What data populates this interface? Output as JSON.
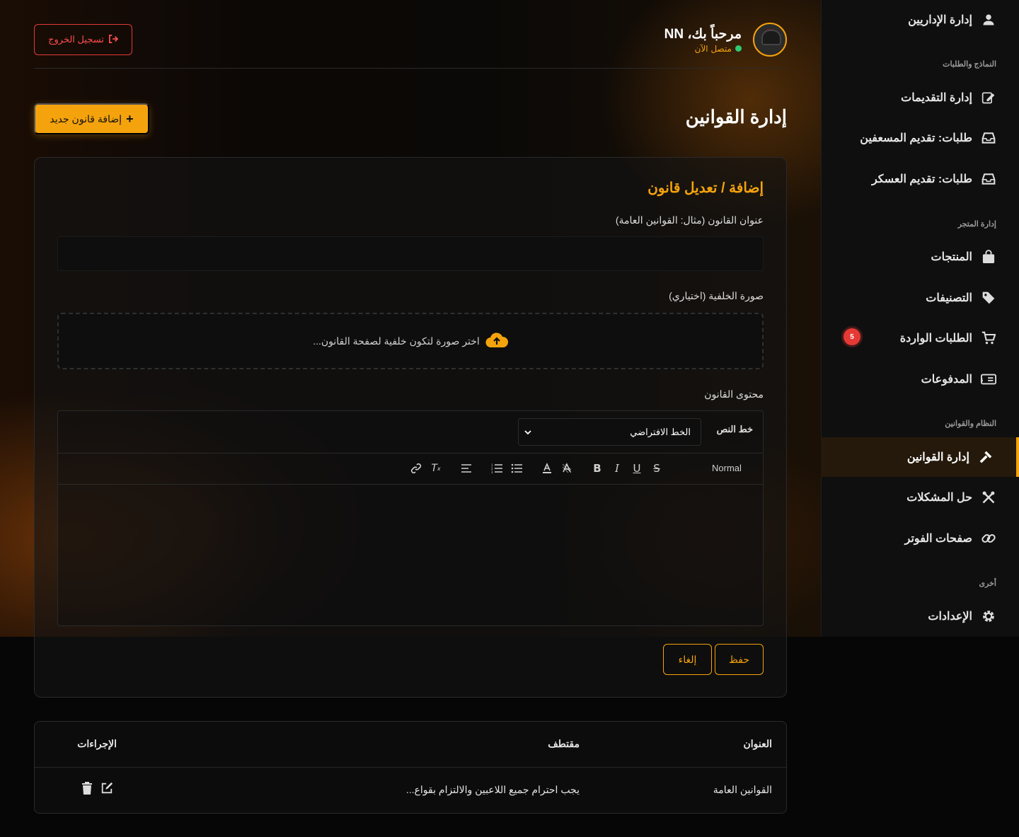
{
  "sidebar": {
    "items": [
      {
        "label": "إدارة الإداريين",
        "icon": "user-icon"
      },
      {
        "label": "إدارة التقديمات",
        "icon": "edit-form-icon"
      },
      {
        "label": "طلبات: تقديم المسعفين",
        "icon": "inbox-icon"
      },
      {
        "label": "طلبات: تقديم العسكر",
        "icon": "inbox-icon"
      },
      {
        "label": "المنتجات",
        "icon": "shopping-bag-icon"
      },
      {
        "label": "التصنيفات",
        "icon": "tags-icon"
      },
      {
        "label": "الطلبات الواردة",
        "icon": "cart-icon",
        "badge": "5"
      },
      {
        "label": "المدفوعات",
        "icon": "money-bill-icon"
      },
      {
        "label": "إدارة القوانين",
        "icon": "gavel-icon",
        "active": true
      },
      {
        "label": "حل المشكلات",
        "icon": "tools-icon"
      },
      {
        "label": "صفحات الفوتر",
        "icon": "link-icon"
      },
      {
        "label": "الإعدادات",
        "icon": "gear-icon"
      }
    ],
    "sections": {
      "forms": "النماذج والطلبات",
      "store": "إدارة المتجر",
      "system": "النظام والقوانين",
      "other": "أخرى"
    }
  },
  "header": {
    "welcome": "مرحباً بك، NN",
    "status": "متصل الآن",
    "logout_label": "تسجيل الخروج"
  },
  "page": {
    "title": "إدارة القوانين",
    "add_button": "إضافة قانون جديد"
  },
  "form": {
    "title": "إضافة / تعديل قانون",
    "title_label": "عنوان القانون (مثال: القوانين العامة)",
    "title_value": "",
    "bg_label": "صورة الخلفية (اختياري)",
    "upload_text": "اختر صورة لتكون خلفية لصفحة القانون...",
    "content_label": "محتوى القانون",
    "font_label": "خط النص",
    "font_value": "الخط الافتراضي",
    "heading_value": "Normal",
    "save": "حفظ",
    "cancel": "إلغاء"
  },
  "table": {
    "headers": [
      "العنوان",
      "مقتطف",
      "الإجراءات"
    ],
    "rows": [
      {
        "title": "القوانين العامة",
        "excerpt": "يجب احترام جميع اللاعبين والالتزام بقواع..."
      }
    ]
  },
  "colors": {
    "accent": "#f5a30c",
    "danger": "#e53935",
    "online": "#2ecc71"
  }
}
